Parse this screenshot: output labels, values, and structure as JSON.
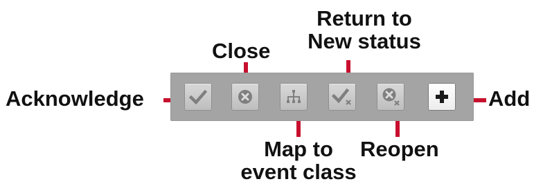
{
  "callouts": {
    "acknowledge": "Acknowledge",
    "close": "Close",
    "return_to_new_line1": "Return to",
    "return_to_new_line2": "New status",
    "map_line1": "Map to",
    "map_line2": "event class",
    "reopen": "Reopen",
    "add": "Add"
  },
  "toolbar": {
    "buttons": [
      {
        "name": "acknowledge",
        "icon": "checkmark-icon"
      },
      {
        "name": "close",
        "icon": "circle-x-icon"
      },
      {
        "name": "map-to-event-class",
        "icon": "hierarchy-icon"
      },
      {
        "name": "return-to-new-status",
        "icon": "checkmark-x-icon"
      },
      {
        "name": "reopen",
        "icon": "circle-x-small-x-icon"
      },
      {
        "name": "add",
        "icon": "plus-icon"
      }
    ]
  },
  "colors": {
    "connector": "#c8102e",
    "toolbar_bg": "#a4a4a4",
    "icon": "#7f7f7f",
    "icon_dark": "#1a1a1a"
  }
}
